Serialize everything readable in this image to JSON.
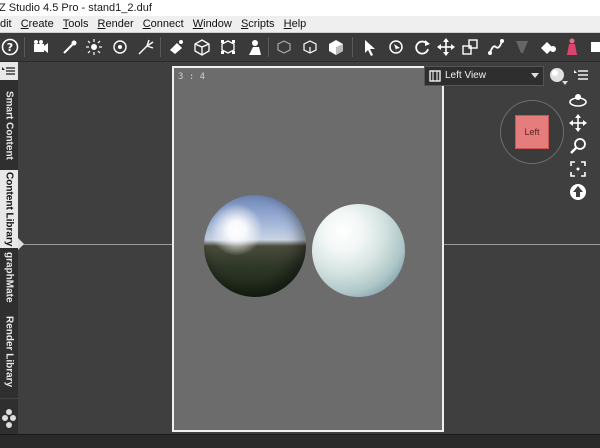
{
  "window": {
    "title": "Z Studio 4.5 Pro - stand1_2.duf"
  },
  "menu": {
    "items": [
      {
        "label": "dit",
        "accel": ""
      },
      {
        "label": "Create",
        "accel": "C"
      },
      {
        "label": "Tools",
        "accel": "T"
      },
      {
        "label": "Render",
        "accel": "R"
      },
      {
        "label": "Connect",
        "accel": "C"
      },
      {
        "label": "Window",
        "accel": "W"
      },
      {
        "label": "Scripts",
        "accel": "S"
      },
      {
        "label": "Help",
        "accel": "H"
      }
    ]
  },
  "sidebar": {
    "tabs": [
      {
        "label": "Smart Content",
        "active": false
      },
      {
        "label": "Content Library",
        "active": true
      },
      {
        "label": "graphMate",
        "active": false
      },
      {
        "label": "Render Library",
        "active": false
      }
    ]
  },
  "viewport": {
    "aspect_label": "3 : 4",
    "view_selector": "Left View",
    "cube_label": "Left"
  },
  "colors": {
    "accent_cube": "#e57d7d",
    "canvas_bg": "#6c6c6c",
    "ui_dark": "#3f3f3f"
  }
}
